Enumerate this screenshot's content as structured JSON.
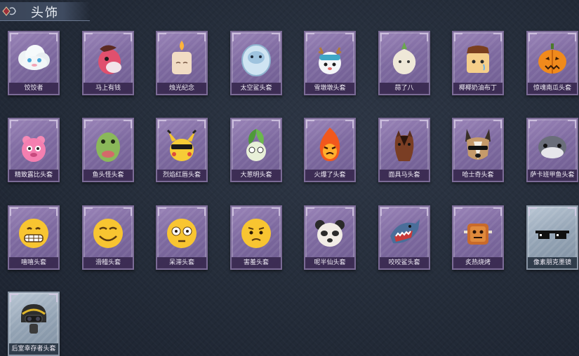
{
  "header": {
    "title": "头饰",
    "emblem_icon": "crest-icon"
  },
  "items": [
    {
      "label": "饺饺者",
      "icon": "cloud-face-icon",
      "rarity": "purple"
    },
    {
      "label": "马上有钱",
      "icon": "horse-head-icon",
      "rarity": "purple"
    },
    {
      "label": "烛光纪念",
      "icon": "candle-icon",
      "rarity": "purple"
    },
    {
      "label": "太空鲨头套",
      "icon": "space-shark-icon",
      "rarity": "purple"
    },
    {
      "label": "雪墩墩头套",
      "icon": "snow-deer-icon",
      "rarity": "purple"
    },
    {
      "label": "蒜了八",
      "icon": "garlic-icon",
      "rarity": "purple"
    },
    {
      "label": "椰椰奶油布丁",
      "icon": "pudding-icon",
      "rarity": "purple"
    },
    {
      "label": "惊魂南瓜头套",
      "icon": "pumpkin-icon",
      "rarity": "purple"
    },
    {
      "label": "精致露比头套",
      "icon": "pink-blob-icon",
      "rarity": "purple"
    },
    {
      "label": "鱼头怪头套",
      "icon": "fish-head-icon",
      "rarity": "purple"
    },
    {
      "label": "烈焰红唇头套",
      "icon": "pikachu-shades-icon",
      "rarity": "purple"
    },
    {
      "label": "大葱明头套",
      "icon": "bok-choy-icon",
      "rarity": "purple"
    },
    {
      "label": "火爆了头套",
      "icon": "fire-spirit-icon",
      "rarity": "purple"
    },
    {
      "label": "面具马头套",
      "icon": "horse-mask-icon",
      "rarity": "purple"
    },
    {
      "label": "哈士奇头套",
      "icon": "husky-icon",
      "rarity": "purple"
    },
    {
      "label": "萨卡班甲鱼头套",
      "icon": "armored-fish-icon",
      "rarity": "purple"
    },
    {
      "label": "嘻嘻头套",
      "icon": "grin-emoji-icon",
      "rarity": "purple"
    },
    {
      "label": "滑稽头套",
      "icon": "smirk-emoji-icon",
      "rarity": "purple"
    },
    {
      "label": "呆滞头套",
      "icon": "dazed-emoji-icon",
      "rarity": "purple"
    },
    {
      "label": "害羞头套",
      "icon": "shy-emoji-icon",
      "rarity": "purple"
    },
    {
      "label": "呢半仙头套",
      "icon": "panda-icon",
      "rarity": "purple"
    },
    {
      "label": "咬咬鲨头套",
      "icon": "shark-bite-icon",
      "rarity": "purple"
    },
    {
      "label": "炙热烧烤",
      "icon": "toast-icon",
      "rarity": "purple"
    },
    {
      "label": "像素朋克墨镜",
      "icon": "pixel-sunglasses-icon",
      "rarity": "silver"
    },
    {
      "label": "后室幸存者头套",
      "icon": "gas-mask-helmet-icon",
      "rarity": "silver"
    }
  ]
}
